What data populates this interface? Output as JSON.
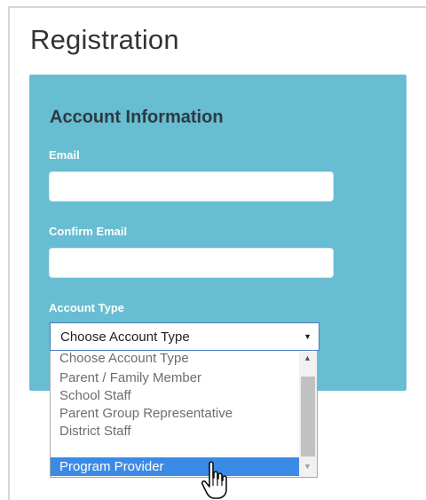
{
  "page": {
    "title": "Registration"
  },
  "form": {
    "section_title": "Account Information",
    "email_label": "Email",
    "email_value": "",
    "confirm_email_label": "Confirm Email",
    "confirm_email_value": "",
    "account_type_label": "Account Type",
    "account_type_selected": "Choose Account Type"
  },
  "dropdown": {
    "options": [
      "Choose Account Type",
      "Parent / Family Member",
      "School Staff",
      "Parent Group Representative",
      "District Staff",
      "Program Provider"
    ],
    "highlighted": "Program Provider"
  },
  "colors": {
    "panel": "#67bdd1",
    "highlight": "#3b8ae6",
    "section_title": "#2d3940"
  },
  "icons": {
    "select_arrow": "chevron-down-icon",
    "cursor": "hand-pointer-icon"
  }
}
